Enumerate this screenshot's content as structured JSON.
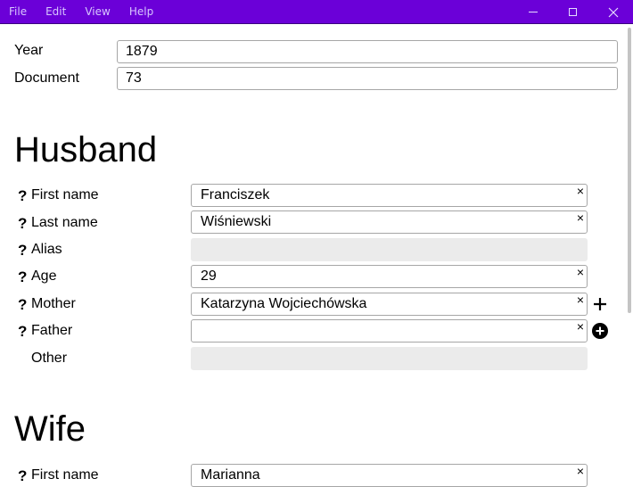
{
  "menu": [
    "File",
    "Edit",
    "View",
    "Help"
  ],
  "form": {
    "year_label": "Year",
    "year_value": "1879",
    "document_label": "Document",
    "document_value": "73"
  },
  "husband": {
    "heading": "Husband",
    "fields": [
      {
        "q": "?",
        "label": "First name",
        "value": "Franciszek",
        "clear": "×"
      },
      {
        "q": "?",
        "label": "Last name",
        "value": "Wiśniewski",
        "clear": "×"
      },
      {
        "q": "?",
        "label": "Alias",
        "value": ""
      },
      {
        "q": "?",
        "label": "Age",
        "value": "29",
        "clear": "×"
      },
      {
        "q": "?",
        "label": "Mother",
        "value": "Katarzyna Wojciechówska",
        "clear": "×",
        "action": "plus-icon"
      },
      {
        "q": "?",
        "label": "Father",
        "value": "",
        "clear": "×",
        "action": "plus-circle-icon"
      },
      {
        "label": "Other",
        "value": ""
      }
    ]
  },
  "wife": {
    "heading": "Wife",
    "fields": [
      {
        "q": "?",
        "label": "First name",
        "value": "Marianna",
        "clear": "×"
      }
    ]
  },
  "window_controls": [
    "minimize-icon",
    "maximize-icon",
    "close-icon"
  ],
  "colors": {
    "titlebar": "#6b00d8",
    "disabled_field": "#ebebeb"
  }
}
